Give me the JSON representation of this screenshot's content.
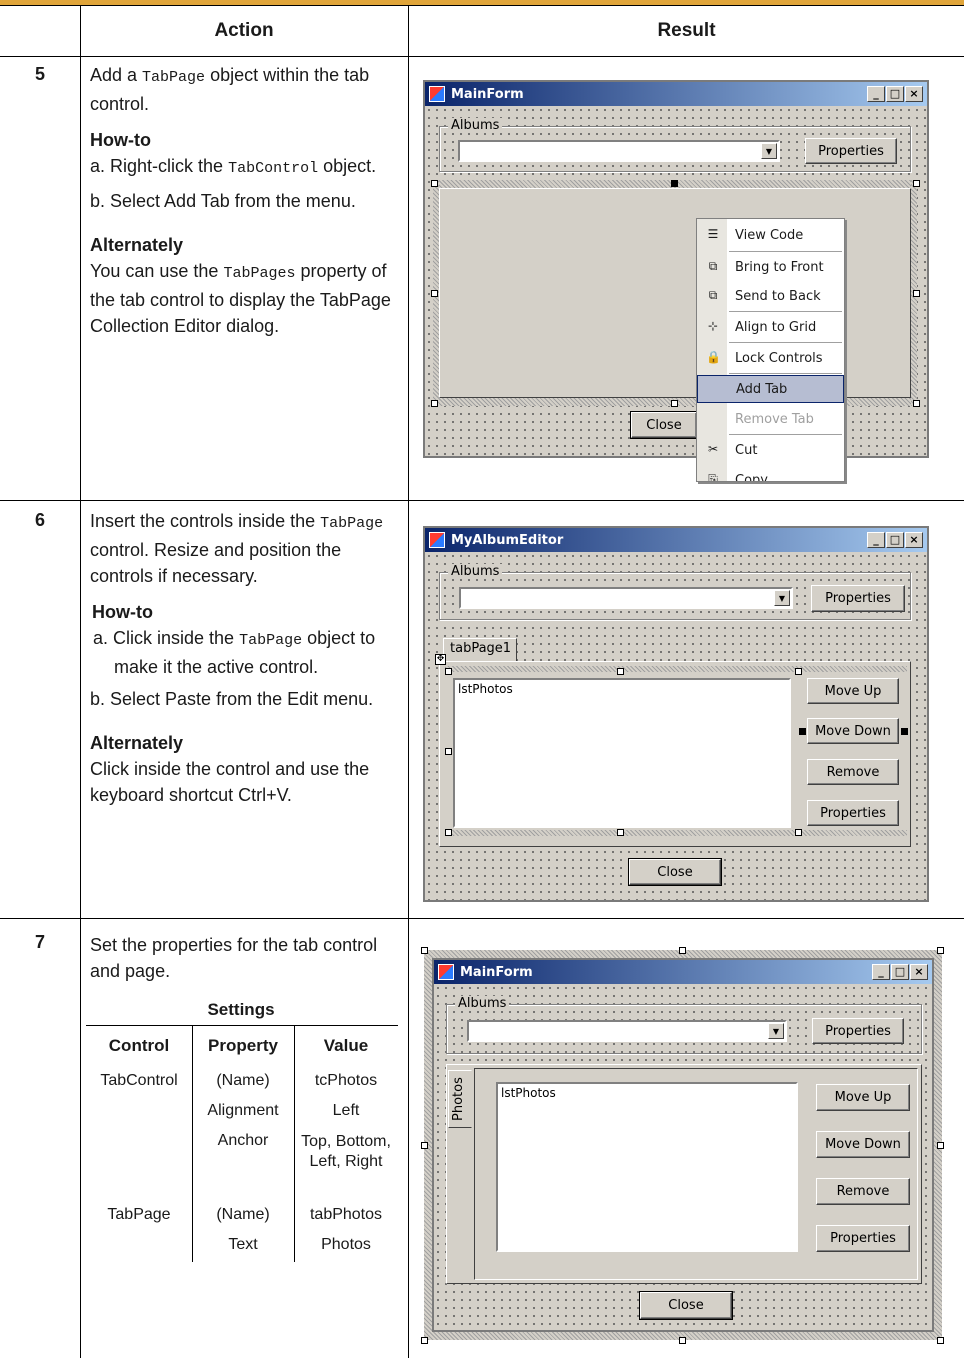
{
  "header": {
    "action": "Action",
    "result": "Result"
  },
  "step5": {
    "number": "5",
    "p1_a": "Add a ",
    "p1_code": "TabPage",
    "p1_b": " object within the tab control.",
    "howto": "How-to",
    "a_prefix": "a. Right-click the ",
    "a_code": "TabControl",
    "a_suffix": " object.",
    "b": "b. Select Add Tab from the menu.",
    "alt": "Alternately",
    "alt_a": "You can use the ",
    "alt_code": "TabPages",
    "alt_b": " property of the tab control to display the TabPage Collection Editor dialog.",
    "window_title": "MainForm",
    "group_label": "Albums",
    "properties_btn": "Properties",
    "close_btn": "Close",
    "menu": [
      "View Code",
      "Bring to Front",
      "Send to Back",
      "Align to Grid",
      "Lock Controls",
      "Add Tab",
      "Remove Tab",
      "Cut",
      "Copy"
    ]
  },
  "step6": {
    "number": "6",
    "p1_a": "Insert the controls inside the ",
    "p1_code": "TabPage",
    "p1_b": " control. Resize and position the controls if necessary.",
    "howto": "How-to",
    "a_prefix": "a. Click inside the ",
    "a_code": "TabPage",
    "a_suffix": " object to make it the active control.",
    "b": "b. Select Paste from the Edit menu.",
    "alt": "Alternately",
    "alt_text": "Click inside the control and use the keyboard shortcut Ctrl+V.",
    "window_title": "MyAlbumEditor",
    "group_label": "Albums",
    "properties_btn": "Properties",
    "tab_label": "tabPage1",
    "list_label": "lstPhotos",
    "move_up": "Move Up",
    "move_down": "Move Down",
    "remove": "Remove",
    "properties2": "Properties",
    "close_btn": "Close"
  },
  "step7": {
    "number": "7",
    "p1": "Set the properties for the tab control and page.",
    "settings_title": "Settings",
    "columns": [
      "Control",
      "Property",
      "Value"
    ],
    "rows": [
      [
        "TabControl",
        "(Name)",
        "tcPhotos"
      ],
      [
        "",
        "Alignment",
        "Left"
      ],
      [
        "",
        "Anchor",
        "Top, Bottom, Left, Right"
      ],
      [
        "TabPage",
        "(Name)",
        "tabPhotos"
      ],
      [
        "",
        "Text",
        "Photos"
      ]
    ],
    "window_title": "MainForm",
    "group_label": "Albums",
    "properties_btn": "Properties",
    "tab_label": "Photos",
    "list_label": "lstPhotos",
    "move_up": "Move Up",
    "move_down": "Move Down",
    "remove": "Remove",
    "properties2": "Properties",
    "close_btn": "Close"
  }
}
